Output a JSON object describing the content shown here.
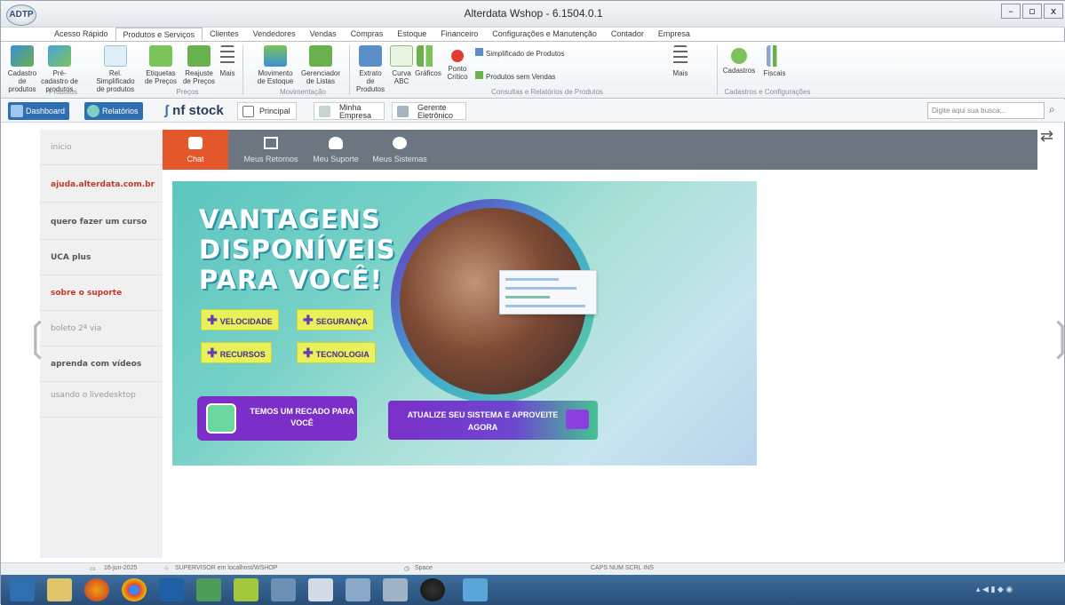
{
  "window": {
    "app_logo": "ADTP",
    "title": "Alterdata Wshop - 6.1504.0.1",
    "buttons": {
      "minimize": "–",
      "restore": "▫",
      "close": "x"
    }
  },
  "ribbon_tabs": [
    "Acesso Rápido",
    "Produtos e Serviços",
    "Clientes",
    "Vendedores",
    "Vendas",
    "Compras",
    "Estoque",
    "Financeiro",
    "Configurações e Manutenção",
    "Contador",
    "Empresa"
  ],
  "ribbon": {
    "buttons": [
      "Cadastro de produtos",
      "Pré-cadastro de produtos",
      "Rel. Simplificado de produtos",
      "Etiquetas de Preços",
      "Reajuste de Preços",
      "Mais",
      "Movimento de Estoque",
      "Gerenciador de Listas",
      "Extrato de Produtos",
      "Curva ABC",
      "Gráficos",
      "Ponto Crítico",
      "Mais",
      "Cadastros",
      "Fiscais"
    ],
    "list_items": [
      "Simplificado de Produtos",
      "Produtos sem Vendas"
    ],
    "groups": [
      "Produtos",
      "Preços",
      "Movimentação",
      "Consultas e Relatórios de Produtos",
      "Cadastros e Configurações"
    ]
  },
  "quickbar": {
    "dashboard": "Dashboard",
    "relatorios": "Relatórios",
    "nfstock": "nf stock",
    "principal": "Principal",
    "minha_empresa": "Minha Empresa",
    "gerente": "Gerente Eletrônico",
    "search_placeholder": "Digite aqui sua busca..."
  },
  "sidebar": {
    "items": [
      {
        "label": "início",
        "color": "#a0a0a0"
      },
      {
        "label": "ajuda.alterdata.com.br",
        "color": "#c0392b"
      },
      {
        "label": "quero fazer um curso",
        "color": "#555555"
      },
      {
        "label": "UCA plus",
        "color": "#555555"
      },
      {
        "label": "sobre o suporte",
        "color": "#c0392b"
      },
      {
        "label": "boleto 2ª via",
        "color": "#999999"
      },
      {
        "label": "aprenda com vídeos",
        "color": "#555555"
      },
      {
        "label": "usando o livedesktop",
        "color": "#999999"
      }
    ]
  },
  "topnav": {
    "items": [
      "Chat",
      "Meus Retornos",
      "Meu Suporte",
      "Meus Sistemas"
    ],
    "active_color": "#e3572b"
  },
  "banner": {
    "line1": "VANTAGENS",
    "line2": "DISPONÍVEIS",
    "line3": "PARA VOCÊ!",
    "tags": [
      "VELOCIDADE",
      "SEGURANÇA",
      "RECURSOS",
      "TECNOLOGIA"
    ],
    "recado": "TEMOS UM RECADO PARA VOCÊ",
    "atualize": "ATUALIZE SEU SISTEMA E APROVEITE AGORA"
  },
  "statusbar": {
    "date": "16-jun-2025",
    "user": "SUPERVISOR em localhost/WSHOP",
    "space": "Space",
    "keys": "CAPS  NUM  SCRL  INS"
  }
}
